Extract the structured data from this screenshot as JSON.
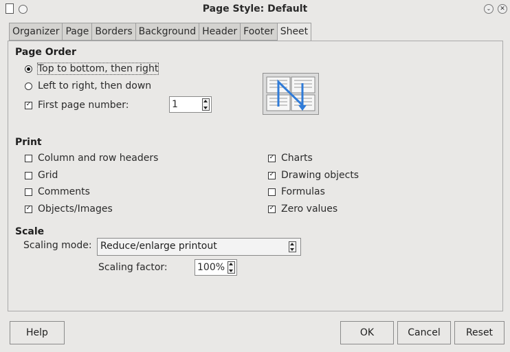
{
  "window": {
    "title": "Page Style: Default"
  },
  "tabs": [
    "Organizer",
    "Page",
    "Borders",
    "Background",
    "Header",
    "Footer",
    "Sheet"
  ],
  "page_order": {
    "heading": "Page Order",
    "top_bottom": "Top to bottom, then right",
    "left_right": "Left to right, then down",
    "first_page": "First page number:",
    "first_page_value": "1"
  },
  "print": {
    "heading": "Print",
    "left": [
      {
        "label": "Column and row headers",
        "checked": false
      },
      {
        "label": "Grid",
        "checked": false
      },
      {
        "label": "Comments",
        "checked": false
      },
      {
        "label": "Objects/Images",
        "checked": true
      }
    ],
    "right": [
      {
        "label": "Charts",
        "checked": true
      },
      {
        "label": "Drawing objects",
        "checked": true
      },
      {
        "label": "Formulas",
        "checked": false
      },
      {
        "label": "Zero values",
        "checked": true
      }
    ]
  },
  "scale": {
    "heading": "Scale",
    "mode_label": "Scaling mode:",
    "mode_value": "Reduce/enlarge printout",
    "factor_label": "Scaling factor:",
    "factor_value": "100%"
  },
  "buttons": {
    "help": "Help",
    "ok": "OK",
    "cancel": "Cancel",
    "reset": "Reset"
  }
}
